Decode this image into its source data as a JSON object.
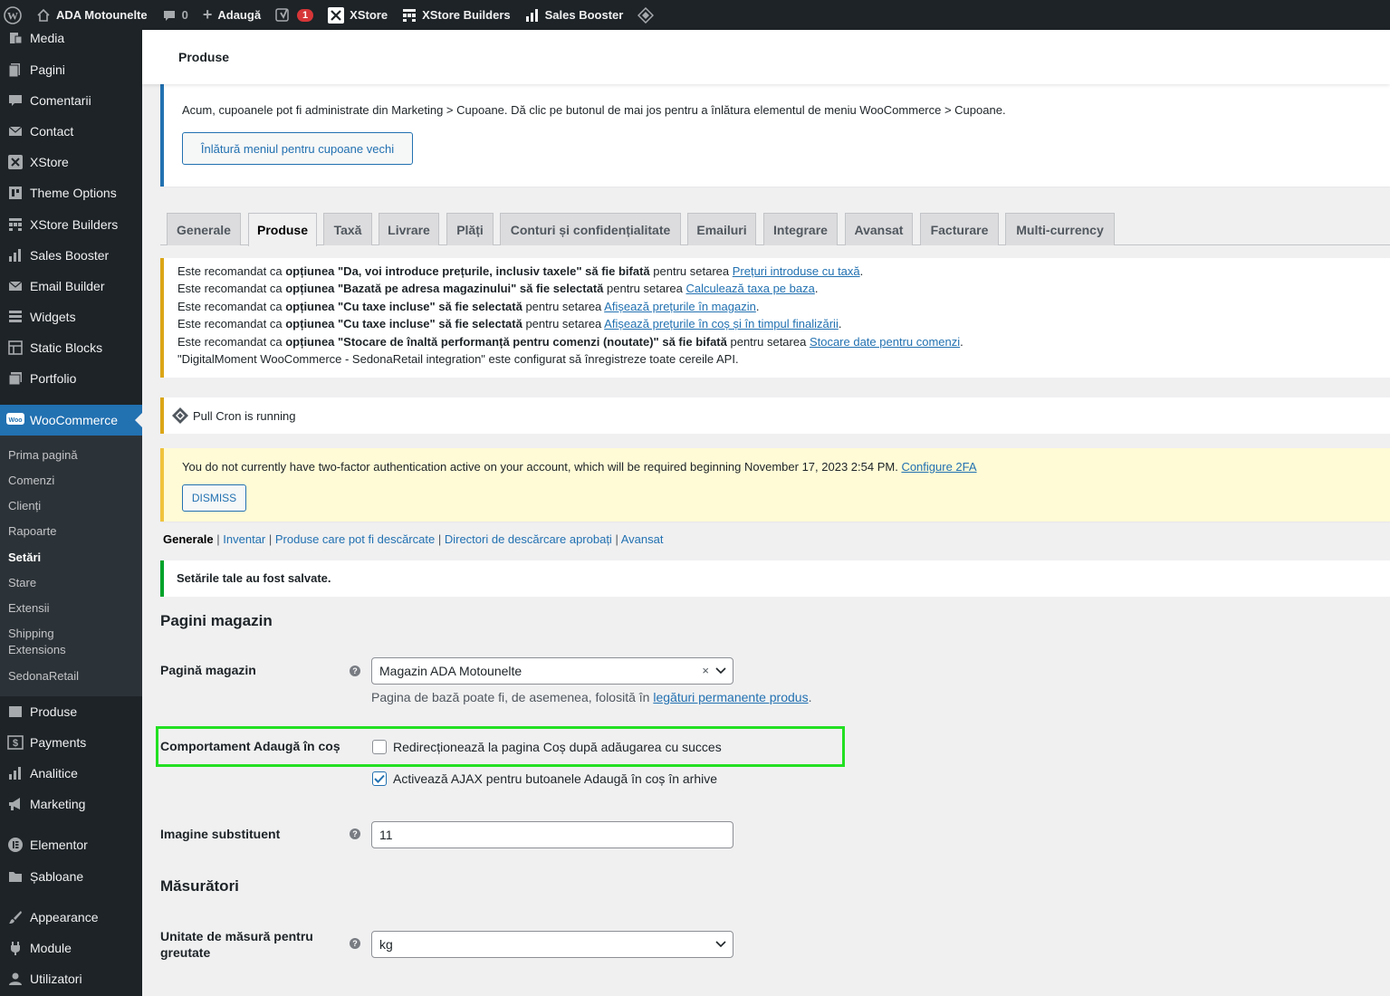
{
  "admin_bar": {
    "site_name": "ADA Motounelte",
    "comments_count": "0",
    "add_new": "Adaugă",
    "yoast_badge": "1",
    "xstore": "XStore",
    "xstore_builders": "XStore Builders",
    "sales_booster": "Sales Booster"
  },
  "sidebar": {
    "items_top": [
      "Media",
      "Pagini",
      "Comentarii",
      "Contact",
      "XStore",
      "Theme Options",
      "XStore Builders",
      "Sales Booster",
      "Email Builder",
      "Widgets",
      "Static Blocks",
      "Portfolio"
    ],
    "woocommerce": "WooCommerce",
    "woo_sub": [
      "Prima pagină",
      "Comenzi",
      "Clienți",
      "Rapoarte",
      "Setări",
      "Stare",
      "Extensii",
      "Shipping",
      "Extensions",
      "SedonaRetail"
    ],
    "items_bottom": [
      "Produse",
      "Payments",
      "Analitice",
      "Marketing",
      "Elementor",
      "Șabloane",
      "Appearance",
      "Module",
      "Utilizatori"
    ]
  },
  "topbar": {
    "title": "Produse"
  },
  "coupon_notice": {
    "text": "Acum, cupoanele pot fi administrate din Marketing > Cupoane. Dă clic pe butonul de mai jos pentru a înlătura elementul de meniu WooCommerce > Cupoane.",
    "button": "Înlătură meniul pentru cupoane vechi"
  },
  "tabs": [
    "Generale",
    "Produse",
    "Taxă",
    "Livrare",
    "Plăți",
    "Conturi și confidențialitate",
    "Emailuri",
    "Integrare",
    "Avansat",
    "Facturare",
    "Multi-currency"
  ],
  "tax_notice": {
    "l1": {
      "a": "Este recomandat ca ",
      "b": "opțiunea \"Da, voi introduce prețurile, inclusiv taxele\" să fie bifată",
      "c": " pentru setarea ",
      "link": "Prețuri introduse cu taxă",
      "d": "."
    },
    "l2": {
      "a": "Este recomandat ca ",
      "b": "opțiunea \"Bazată pe adresa magazinului\" să fie selectată",
      "c": " pentru setarea ",
      "link": "Calculează taxa pe baza",
      "d": "."
    },
    "l3": {
      "a": "Este recomandat ca ",
      "b": "opțiunea \"Cu taxe incluse\" să fie selectată",
      "c": " pentru setarea ",
      "link": "Afișează prețurile în magazin",
      "d": "."
    },
    "l4": {
      "a": "Este recomandat ca ",
      "b": "opțiunea \"Cu taxe incluse\" să fie selectată",
      "c": " pentru setarea ",
      "link": "Afișează prețurile în coș și în timpul finalizării",
      "d": "."
    },
    "l5": {
      "a": "Este recomandat ca ",
      "b": "opțiunea \"Stocare de înaltă performanță pentru comenzi (noutate)\" să fie bifată",
      "c": " pentru setarea ",
      "link": "Stocare date pentru comenzi",
      "d": "."
    },
    "l6": "\"DigitalMoment WooCommerce - SedonaRetail integration\" este configurat să înregistreze toate cereile API."
  },
  "cron_notice": "Pull Cron is running",
  "twofa_notice": {
    "text": "You do not currently have two-factor authentication active on your account, which will be required beginning November 17, 2023 2:54 PM. ",
    "link": "Configure 2FA",
    "button": "DISMISS"
  },
  "subsub": {
    "current": "Generale",
    "links": [
      "Inventar",
      "Produse care pot fi descărcate",
      "Directori de descărcare aprobați",
      "Avansat"
    ]
  },
  "saved_notice": "Setările tale au fost salvate.",
  "section_shop": {
    "title": "Pagini magazin",
    "shop_page_label": "Pagină magazin",
    "shop_page_value": "Magazin ADA Motounelte",
    "shop_page_desc": "Pagina de bază poate fi, de asemenea, folosită în ",
    "shop_page_desc_link": "legături permanente produs",
    "shop_page_desc_end": ".",
    "cart_behaviour_label": "Comportament Adaugă în coș",
    "cb_redirect": "Redirecționează la pagina Coș după adăugarea cu succes",
    "cb_redirect_checked": false,
    "cb_ajax": "Activează AJAX pentru butoanele Adaugă în coș în arhive",
    "cb_ajax_checked": true,
    "placeholder_label": "Imagine substituent",
    "placeholder_value": "11"
  },
  "section_measure": {
    "title": "Măsurători",
    "weight_label_1": "Unitate de măsură pentru",
    "weight_label_2": "greutate",
    "weight_value": "kg"
  }
}
